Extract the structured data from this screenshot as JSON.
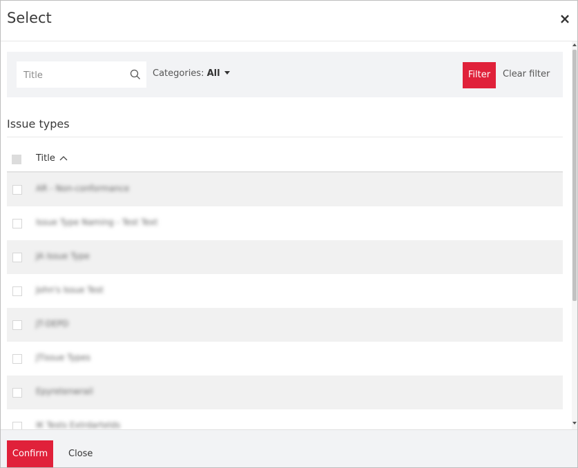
{
  "dialog": {
    "title": "Select",
    "close_icon": "×"
  },
  "filter": {
    "search_placeholder": "Title",
    "search_icon": "search-icon",
    "categories_label": "Categories:",
    "categories_value": "All",
    "filter_button": "Filter",
    "clear_filter": "Clear filter"
  },
  "section": {
    "title": "Issue types"
  },
  "table": {
    "column_title": "Title",
    "sort": "ascending",
    "rows": [
      {
        "title": "AR - Non-conformance"
      },
      {
        "title": "Issue Type Naming - Test Text"
      },
      {
        "title": "JA Issue Type"
      },
      {
        "title": "John's Issue Test"
      },
      {
        "title": "JT-DEPD"
      },
      {
        "title": "JTissue Types"
      },
      {
        "title": "Epyretenwrail"
      },
      {
        "title": "IK Tests Extrdartelds"
      }
    ]
  },
  "footer": {
    "confirm": "Confirm",
    "close": "Close"
  },
  "colors": {
    "accent": "#e0213a",
    "filter_bg": "#f2f3f5",
    "row_alt": "#f1f1f1"
  }
}
